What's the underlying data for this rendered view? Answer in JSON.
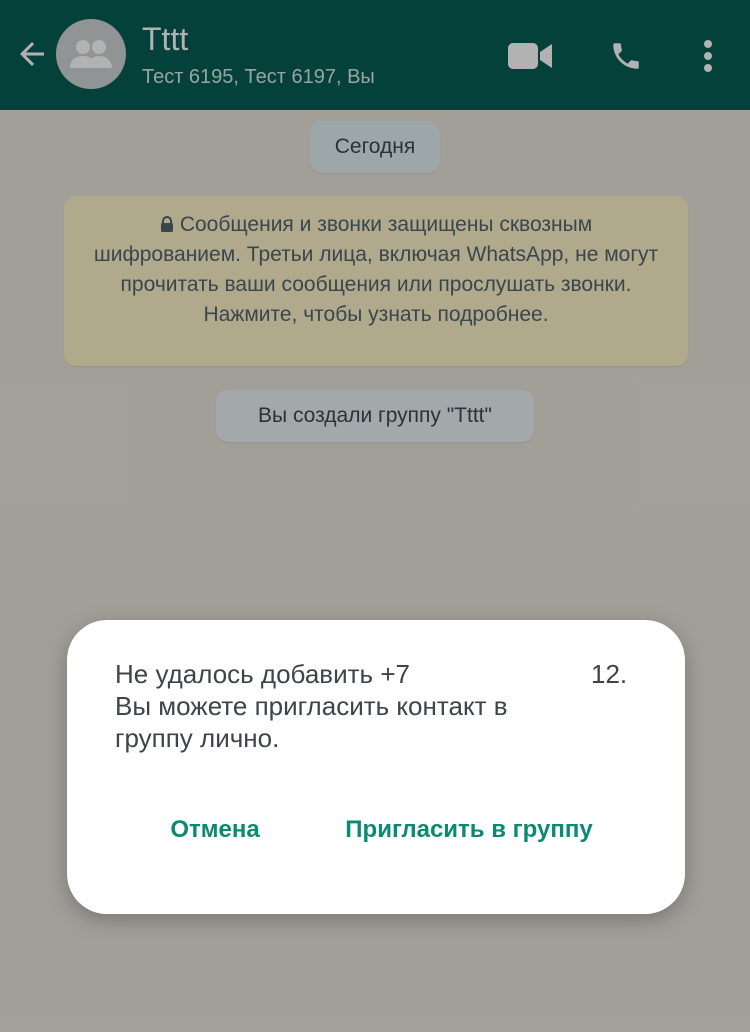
{
  "header": {
    "title": "Tttt",
    "subtitle": "Тест 6195, Тест 6197, Вы",
    "icons": {
      "back": "arrow-left-icon",
      "avatar": "group-avatar-icon",
      "video": "video-call-icon",
      "call": "phone-icon",
      "more": "more-vertical-icon"
    }
  },
  "chat": {
    "date_label": "Сегодня",
    "encryption_notice": "Сообщения и звонки защищены сквозным шифрованием. Третьи лица, включая WhatsApp, не могут прочитать ваши сообщения или прослушать звонки. Нажмите, чтобы узнать подробнее.",
    "system_message": "Вы создали группу \"Tttt\""
  },
  "dialog": {
    "line1_start": "Не удалось добавить +7",
    "line1_end": "12.",
    "line2": "Вы можете пригласить контакт в",
    "line3": "группу лично.",
    "cancel_label": "Отмена",
    "invite_label": "Пригласить в группу"
  },
  "colors": {
    "header_bg": "#075e54",
    "accent": "#0b8a73",
    "encryption_bg": "#fdf3c7",
    "chat_bg": "#e9e4dc"
  }
}
